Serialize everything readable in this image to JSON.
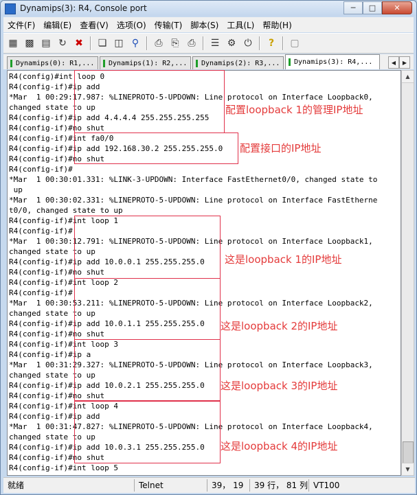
{
  "window": {
    "title": "Dynamips(3): R4, Console port"
  },
  "menu": [
    "文件(F)",
    "编辑(E)",
    "查看(V)",
    "选项(O)",
    "传输(T)",
    "脚本(S)",
    "工具(L)",
    "帮助(H)"
  ],
  "toolbar_icons": [
    "connect-icon",
    "quick-connect-icon",
    "connect-tab-icon",
    "reconnect-icon",
    "disconnect-icon",
    "copy-icon",
    "paste-icon",
    "find-icon",
    "print-icon",
    "print-setup-icon",
    "print-screen-icon",
    "session-options-icon",
    "global-options-icon",
    "keymap-icon",
    "help-icon",
    "sftp-icon"
  ],
  "tabs": [
    {
      "label": "Dynamips(0): R1,...",
      "active": false
    },
    {
      "label": "Dynamips(1): R2,...",
      "active": false
    },
    {
      "label": "Dynamips(2): R3,...",
      "active": false
    },
    {
      "label": "Dynamips(3): R4,...",
      "active": true
    }
  ],
  "console_lines": [
    "R4(config)#int loop 0",
    "R4(config-if)#ip add",
    "*Mar  1 00:29:17.987: %LINEPROTO-5-UPDOWN: Line protocol on Interface Loopback0,",
    "changed state to up",
    "R4(config-if)#ip add 4.4.4.4 255.255.255.255",
    "R4(config-if)#no shut",
    "R4(config-if)#int fa0/0",
    "R4(config-if)#ip add 192.168.30.2 255.255.255.0",
    "R4(config-if)#no shut",
    "R4(config-if)#",
    "*Mar  1 00:30:01.331: %LINK-3-UPDOWN: Interface FastEthernet0/0, changed state to",
    " up",
    "*Mar  1 00:30:02.331: %LINEPROTO-5-UPDOWN: Line protocol on Interface FastEtherne",
    "t0/0, changed state to up",
    "R4(config-if)#int loop 1",
    "R4(config-if)#",
    "*Mar  1 00:30:12.791: %LINEPROTO-5-UPDOWN: Line protocol on Interface Loopback1,",
    "changed state to up",
    "R4(config-if)#ip add 10.0.0.1 255.255.255.0",
    "R4(config-if)#no shut",
    "R4(config-if)#int loop 2",
    "R4(config-if)#",
    "*Mar  1 00:30:53.211: %LINEPROTO-5-UPDOWN: Line protocol on Interface Loopback2,",
    "changed state to up",
    "R4(config-if)#ip add 10.0.1.1 255.255.255.0",
    "R4(config-if)#no shut",
    "R4(config-if)#int loop 3",
    "R4(config-if)#ip a",
    "*Mar  1 00:31:29.327: %LINEPROTO-5-UPDOWN: Line protocol on Interface Loopback3,",
    "changed state to up",
    "R4(config-if)#ip add 10.0.2.1 255.255.255.0",
    "R4(config-if)#no shut",
    "R4(config-if)#int loop 4",
    "R4(config-if)#ip add",
    "*Mar  1 00:31:47.827: %LINEPROTO-5-UPDOWN: Line protocol on Interface Loopback4,",
    "changed state to up",
    "R4(config-if)#ip add 10.0.3.1 255.255.255.0",
    "R4(config-if)#no shut",
    "R4(config-if)#int loop 5"
  ],
  "annotations": [
    "配置loopback 1的管理IP地址",
    "配置接口的IP地址",
    "这是loopback 1的IP地址",
    "这是loopback 2的IP地址",
    "这是loopback 3的IP地址",
    "这是loopback 4的IP地址"
  ],
  "colors": {
    "annotation": "#e43b3b",
    "tab_icon": "#1e9e2a"
  },
  "status": {
    "ready": "就绪",
    "protocol": "Telnet",
    "cursor": "39， 19",
    "rows_cols": "39 行， 81 列",
    "terminal": "VT100"
  }
}
